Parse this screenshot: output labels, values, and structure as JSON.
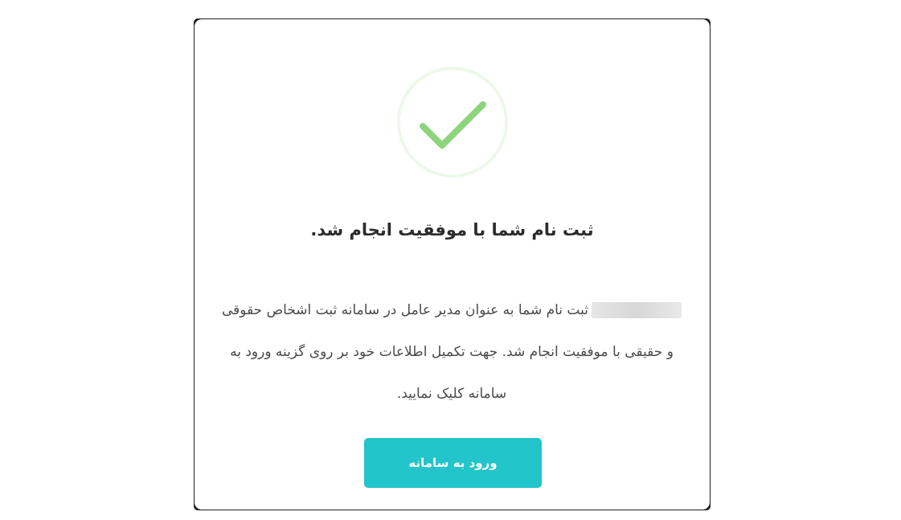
{
  "dialog": {
    "title": "ثبت نام شما با موفقیت انجام شد.",
    "message": "ثبت نام شما به عنوان مدیر عامل در سامانه ثبت اشخاص حقوقی و حقیقی با موفقیت انجام شد. جهت تکمیل اطلاعات خود بر روی گزینه ورود به سامانه کلیک نمایید.",
    "button_label": "ورود به سامانه"
  },
  "colors": {
    "success_check": "#8ed47c",
    "success_ring": "#eef8ea",
    "button_background": "#22c5c9",
    "title_text": "#2c2c2c",
    "body_text": "#4a4a4a"
  },
  "icons": {
    "success": "checkmark-icon"
  }
}
